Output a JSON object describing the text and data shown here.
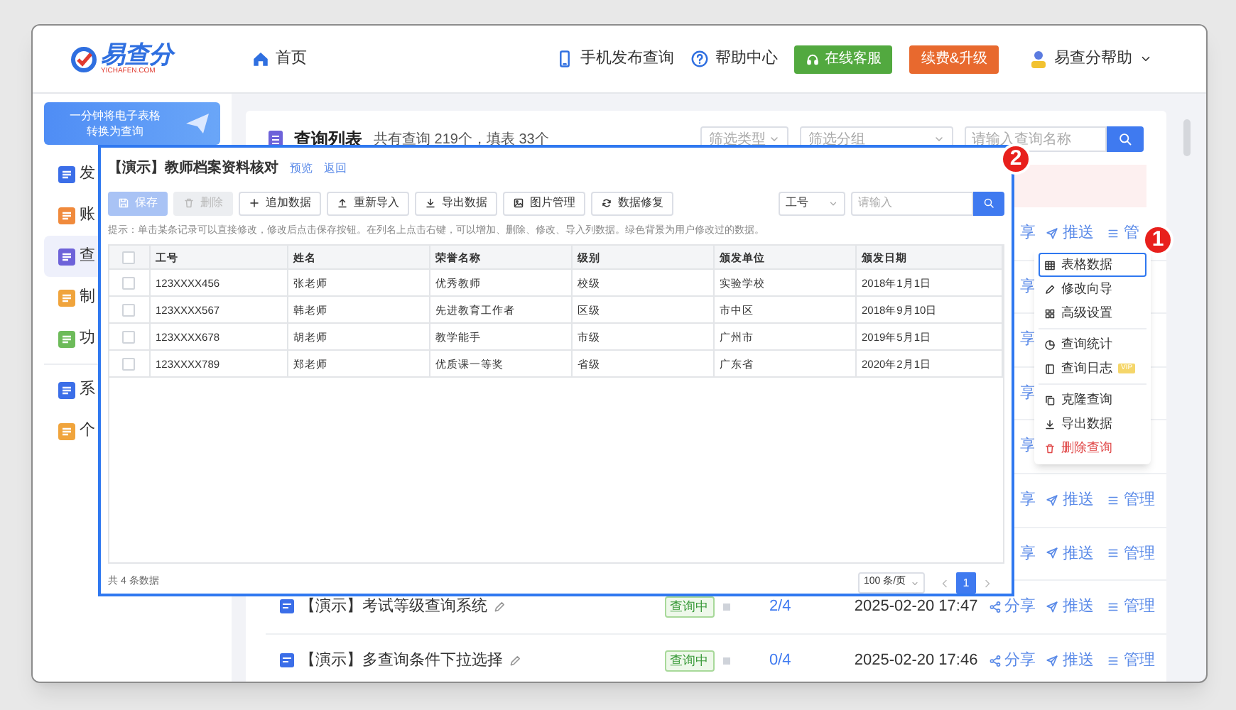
{
  "header": {
    "logo": "易查分",
    "logo_sub": "YICHAFEN.COM",
    "home": "首页",
    "links": [
      "手机发布查询",
      "帮助中心"
    ],
    "buttons": [
      {
        "label": "在线客服",
        "kind": "green"
      },
      {
        "label": "续费&升级",
        "kind": "orange"
      }
    ],
    "user": "易查分帮助"
  },
  "sidebar": {
    "promo": [
      "一分钟将电子表格",
      "转换为查询"
    ],
    "items": [
      {
        "label": "发",
        "color": "#3b6ee8",
        "selected": false
      },
      {
        "label": "账",
        "color": "#f08a3c",
        "selected": false
      },
      {
        "label": "查",
        "color": "#6d62d9",
        "selected": true
      },
      {
        "label": "制",
        "color": "#f0a43c",
        "selected": false
      },
      {
        "label": "功",
        "color": "#6dbb5a",
        "selected": false
      },
      {
        "label": "系",
        "color": "#3b6ee8",
        "selected": false
      },
      {
        "label": "个",
        "color": "#f0a43c",
        "selected": false
      }
    ]
  },
  "query_list": {
    "title": "查询列表",
    "summary": "共有查询 219个，填表 33个",
    "filters": [
      "筛选类型",
      "筛选分组"
    ],
    "search_placeholder": "请输入查询名称",
    "rows": [
      {
        "share": "享",
        "push": "推送",
        "manage": "管"
      },
      {
        "share": "享"
      },
      {
        "share": "享"
      },
      {
        "share": "享"
      },
      {
        "share": "享"
      },
      {
        "share": "享",
        "push": "推送",
        "manage": "管理"
      },
      {
        "share": "享",
        "push": "推送",
        "manage": "管理"
      },
      {
        "title": "【演示】考试等级查询系统",
        "status": "查询中",
        "count": "2/4",
        "date": "2025-02-20 17:47",
        "share": "分享",
        "push": "推送",
        "manage": "管理"
      },
      {
        "title": "【演示】多查询条件下拉选择",
        "status": "查询中",
        "count": "0/4",
        "date": "2025-02-20 17:46",
        "share": "分享",
        "push": "推送",
        "manage": "管理"
      }
    ]
  },
  "modal": {
    "title": "【演示】教师档案资料核对",
    "links": [
      "预览",
      "返回"
    ],
    "toolbar": [
      {
        "label": "保存",
        "kind": "primary",
        "disabled": true
      },
      {
        "label": "删除",
        "kind": "default",
        "disabled": true
      },
      {
        "label": "追加数据",
        "kind": "default",
        "disabled": false
      },
      {
        "label": "重新导入",
        "kind": "default",
        "disabled": false
      },
      {
        "label": "导出数据",
        "kind": "default",
        "disabled": false
      },
      {
        "label": "图片管理",
        "kind": "default",
        "disabled": false
      },
      {
        "label": "数据修复",
        "kind": "default",
        "disabled": false
      }
    ],
    "search_field": "工号",
    "search_placeholder": "请输入",
    "hint": "提示：单击某条记录可以直接修改，修改后点击保存按钮。在列名上点击右键，可以增加、删除、修改、导入列数据。绿色背景为用户修改过的数据。",
    "table": {
      "header_checked": false,
      "columns": [
        "工号",
        "姓名",
        "荣誉名称",
        "级别",
        "颁发单位",
        "颁发日期"
      ],
      "rows": [
        {
          "checked": false,
          "cells": [
            "123XXXX456",
            "张老师",
            "优秀教师",
            "校级",
            "实验学校",
            "2018年1月1日"
          ]
        },
        {
          "checked": false,
          "cells": [
            "123XXXX567",
            "韩老师",
            "先进教育工作者",
            "区级",
            "市中区",
            "2018年9月10日"
          ]
        },
        {
          "checked": false,
          "cells": [
            "123XXXX678",
            "胡老师",
            "教学能手",
            "市级",
            "广州市",
            "2019年5月1日"
          ]
        },
        {
          "checked": false,
          "cells": [
            "123XXXX789",
            "郑老师",
            "优质课一等奖",
            "省级",
            "广东省",
            "2020年2月1日"
          ]
        }
      ]
    },
    "total": "共 4 条数据",
    "page_size": "100 条/页",
    "pages": [
      {
        "label": "1",
        "selected": true
      }
    ]
  },
  "menu": {
    "groups": [
      [
        {
          "label": "表格数据",
          "kind": "normal",
          "selected": true
        },
        {
          "label": "修改向导",
          "kind": "normal",
          "selected": false
        },
        {
          "label": "高级设置",
          "kind": "normal",
          "selected": false
        }
      ],
      [
        {
          "label": "查询统计",
          "kind": "normal",
          "selected": false
        },
        {
          "label": "查询日志",
          "kind": "normal",
          "selected": false,
          "badge": "VIP"
        }
      ],
      [
        {
          "label": "克隆查询",
          "kind": "normal",
          "selected": false
        },
        {
          "label": "导出数据",
          "kind": "normal",
          "selected": false
        },
        {
          "label": "删除查询",
          "kind": "danger",
          "selected": false
        }
      ]
    ]
  },
  "callouts": [
    "1",
    "2"
  ]
}
